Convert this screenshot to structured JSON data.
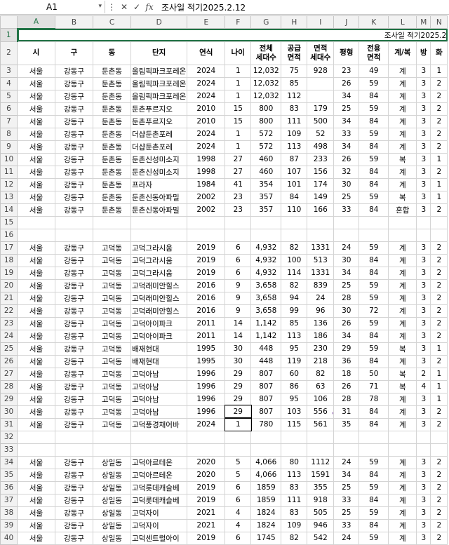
{
  "formula_bar": {
    "name_box": "A1",
    "cancel_icon": "✕",
    "enter_icon": "✓",
    "fx_label": "fx",
    "formula": "조사일 적기2025.2.12"
  },
  "columns": [
    "A",
    "B",
    "C",
    "D",
    "E",
    "F",
    "G",
    "H",
    "I",
    "J",
    "K",
    "L",
    "M",
    "N"
  ],
  "title_row": {
    "row": "1",
    "text": "조사일 적기2025.2"
  },
  "header_row": {
    "row": "2",
    "cells": [
      "시",
      "구",
      "동",
      "단지",
      "연식",
      "나이",
      "전체\n세대수",
      "공급\n면적",
      "면적\n세대수",
      "평형",
      "전용\n면적",
      "계/복",
      "방",
      "화"
    ]
  },
  "rows": [
    {
      "row": "3",
      "cells": [
        "서울",
        "강동구",
        "둔촌동",
        "올림픽파크포레온",
        "2024",
        "1",
        "12,032",
        "75",
        "928",
        "23",
        "49",
        "계",
        "3",
        "1"
      ]
    },
    {
      "row": "4",
      "cells": [
        "서울",
        "강동구",
        "둔촌동",
        "올림픽파크포레온",
        "2024",
        "1",
        "12,032",
        "85",
        "",
        "26",
        "59",
        "계",
        "3",
        "2"
      ]
    },
    {
      "row": "5",
      "cells": [
        "서울",
        "강동구",
        "둔촌동",
        "올림픽파크포레온",
        "2024",
        "1",
        "12,032",
        "112",
        "",
        "34",
        "84",
        "계",
        "3",
        "2"
      ]
    },
    {
      "row": "6",
      "cells": [
        "서울",
        "강동구",
        "둔촌동",
        "둔촌푸르지오",
        "2010",
        "15",
        "800",
        "83",
        "179",
        "25",
        "59",
        "계",
        "3",
        "2"
      ]
    },
    {
      "row": "7",
      "cells": [
        "서울",
        "강동구",
        "둔촌동",
        "둔촌푸르지오",
        "2010",
        "15",
        "800",
        "111",
        "500",
        "34",
        "84",
        "계",
        "3",
        "2"
      ]
    },
    {
      "row": "8",
      "cells": [
        "서울",
        "강동구",
        "둔촌동",
        "더샵둔촌포레",
        "2024",
        "1",
        "572",
        "109",
        "52",
        "33",
        "59",
        "계",
        "3",
        "2"
      ]
    },
    {
      "row": "9",
      "cells": [
        "서울",
        "강동구",
        "둔촌동",
        "더샵둔촌포레",
        "2024",
        "1",
        "572",
        "113",
        "498",
        "34",
        "84",
        "계",
        "3",
        "2"
      ]
    },
    {
      "row": "10",
      "cells": [
        "서울",
        "강동구",
        "둔촌동",
        "둔촌신성미소지",
        "1998",
        "27",
        "460",
        "87",
        "233",
        "26",
        "59",
        "복",
        "3",
        "1"
      ]
    },
    {
      "row": "11",
      "cells": [
        "서울",
        "강동구",
        "둔촌동",
        "둔촌신성미소지",
        "1998",
        "27",
        "460",
        "107",
        "156",
        "32",
        "84",
        "계",
        "3",
        "2"
      ]
    },
    {
      "row": "12",
      "cells": [
        "서울",
        "강동구",
        "둔촌동",
        "프라자",
        "1984",
        "41",
        "354",
        "101",
        "174",
        "30",
        "84",
        "계",
        "3",
        "1"
      ]
    },
    {
      "row": "13",
      "cells": [
        "서울",
        "강동구",
        "둔촌동",
        "둔촌신동아파밀",
        "2002",
        "23",
        "357",
        "84",
        "149",
        "25",
        "59",
        "복",
        "3",
        "1"
      ]
    },
    {
      "row": "14",
      "cells": [
        "서울",
        "강동구",
        "둔촌동",
        "둔촌신동아파밀",
        "2002",
        "23",
        "357",
        "110",
        "166",
        "33",
        "84",
        "혼합",
        "3",
        "2"
      ]
    },
    {
      "row": "15",
      "cells": [
        "",
        "",
        "",
        "",
        "",
        "",
        "",
        "",
        "",
        "",
        "",
        "",
        "",
        ""
      ]
    },
    {
      "row": "16",
      "cells": [
        "",
        "",
        "",
        "",
        "",
        "",
        "",
        "",
        "",
        "",
        "",
        "",
        "",
        ""
      ]
    },
    {
      "row": "17",
      "cells": [
        "서울",
        "강동구",
        "고덕동",
        "고덕그라시움",
        "2019",
        "6",
        "4,932",
        "82",
        "1331",
        "24",
        "59",
        "계",
        "3",
        "2"
      ]
    },
    {
      "row": "18",
      "cells": [
        "서울",
        "강동구",
        "고덕동",
        "고덕그라시움",
        "2019",
        "6",
        "4,932",
        "100",
        "513",
        "30",
        "84",
        "계",
        "3",
        "2"
      ]
    },
    {
      "row": "19",
      "cells": [
        "서울",
        "강동구",
        "고덕동",
        "고덕그라시움",
        "2019",
        "6",
        "4,932",
        "114",
        "1331",
        "34",
        "84",
        "계",
        "3",
        "2"
      ]
    },
    {
      "row": "20",
      "cells": [
        "서울",
        "강동구",
        "고덕동",
        "고덕래미안힐스",
        "2016",
        "9",
        "3,658",
        "82",
        "839",
        "25",
        "59",
        "계",
        "3",
        "2"
      ]
    },
    {
      "row": "21",
      "cells": [
        "서울",
        "강동구",
        "고덕동",
        "고덕래미안힐스",
        "2016",
        "9",
        "3,658",
        "94",
        "24",
        "28",
        "59",
        "계",
        "3",
        "2"
      ]
    },
    {
      "row": "22",
      "cells": [
        "서울",
        "강동구",
        "고덕동",
        "고덕래미안힐스",
        "2016",
        "9",
        "3,658",
        "99",
        "96",
        "30",
        "72",
        "계",
        "3",
        "2"
      ]
    },
    {
      "row": "23",
      "cells": [
        "서울",
        "강동구",
        "고덕동",
        "고덕아이파크",
        "2011",
        "14",
        "1,142",
        "85",
        "136",
        "26",
        "59",
        "계",
        "3",
        "2"
      ]
    },
    {
      "row": "24",
      "cells": [
        "서울",
        "강동구",
        "고덕동",
        "고덕아이파크",
        "2011",
        "14",
        "1,142",
        "113",
        "186",
        "34",
        "84",
        "계",
        "3",
        "2"
      ]
    },
    {
      "row": "25",
      "cells": [
        "서울",
        "강동구",
        "고덕동",
        "배재현대",
        "1995",
        "30",
        "448",
        "95",
        "230",
        "29",
        "59",
        "복",
        "3",
        "1"
      ]
    },
    {
      "row": "26",
      "cells": [
        "서울",
        "강동구",
        "고덕동",
        "배재현대",
        "1995",
        "30",
        "448",
        "119",
        "218",
        "36",
        "84",
        "계",
        "3",
        "2"
      ]
    },
    {
      "row": "27",
      "cells": [
        "서울",
        "강동구",
        "고덕동",
        "고덕아남",
        "1996",
        "29",
        "807",
        "60",
        "82",
        "18",
        "50",
        "복",
        "2",
        "1"
      ]
    },
    {
      "row": "28",
      "cells": [
        "서울",
        "강동구",
        "고덕동",
        "고덕아남",
        "1996",
        "29",
        "807",
        "86",
        "63",
        "26",
        "71",
        "복",
        "4",
        "1"
      ]
    },
    {
      "row": "29",
      "cells": [
        "서울",
        "강동구",
        "고덕동",
        "고덕아남",
        "1996",
        "29",
        "807",
        "95",
        "106",
        "28",
        "78",
        "계",
        "3",
        "1"
      ]
    },
    {
      "row": "30",
      "cells": [
        "서울",
        "강동구",
        "고덕동",
        "고덕아남",
        "1996",
        "29",
        "807",
        "103",
        "556",
        "31",
        "84",
        "계",
        "3",
        "2"
      ]
    },
    {
      "row": "31",
      "cells": [
        "서울",
        "강동구",
        "고덕동",
        "고덕풍경채어바",
        "2024",
        "1",
        "780",
        "115",
        "561",
        "35",
        "84",
        "계",
        "3",
        "2"
      ]
    },
    {
      "row": "32",
      "cells": [
        "",
        "",
        "",
        "",
        "",
        "",
        "",
        "",
        "",
        "",
        "",
        "",
        "",
        ""
      ]
    },
    {
      "row": "33",
      "cells": [
        "",
        "",
        "",
        "",
        "",
        "",
        "",
        "",
        "",
        "",
        "",
        "",
        "",
        ""
      ]
    },
    {
      "row": "34",
      "cells": [
        "서울",
        "강동구",
        "상일동",
        "고덕아르테온",
        "2020",
        "5",
        "4,066",
        "80",
        "1112",
        "24",
        "59",
        "계",
        "3",
        "2"
      ]
    },
    {
      "row": "35",
      "cells": [
        "서울",
        "강동구",
        "상일동",
        "고덕아르테온",
        "2020",
        "5",
        "4,066",
        "113",
        "1591",
        "34",
        "84",
        "계",
        "3",
        "2"
      ]
    },
    {
      "row": "36",
      "cells": [
        "서울",
        "강동구",
        "상일동",
        "고덕롯데캐슬베",
        "2019",
        "6",
        "1859",
        "83",
        "355",
        "25",
        "59",
        "계",
        "3",
        "2"
      ]
    },
    {
      "row": "37",
      "cells": [
        "서울",
        "강동구",
        "상일동",
        "고덕롯데캐슬베",
        "2019",
        "6",
        "1859",
        "111",
        "918",
        "33",
        "84",
        "계",
        "3",
        "2"
      ]
    },
    {
      "row": "38",
      "cells": [
        "서울",
        "강동구",
        "상일동",
        "고덕자이",
        "2021",
        "4",
        "1824",
        "83",
        "505",
        "25",
        "59",
        "계",
        "3",
        "2"
      ]
    },
    {
      "row": "39",
      "cells": [
        "서울",
        "강동구",
        "상일동",
        "고덕자이",
        "2021",
        "4",
        "1824",
        "109",
        "946",
        "33",
        "84",
        "계",
        "3",
        "2"
      ]
    },
    {
      "row": "40",
      "cells": [
        "서울",
        "강동구",
        "상일동",
        "고덕센트럴아이",
        "2019",
        "6",
        "1745",
        "82",
        "542",
        "24",
        "59",
        "계",
        "3",
        "2"
      ]
    }
  ]
}
